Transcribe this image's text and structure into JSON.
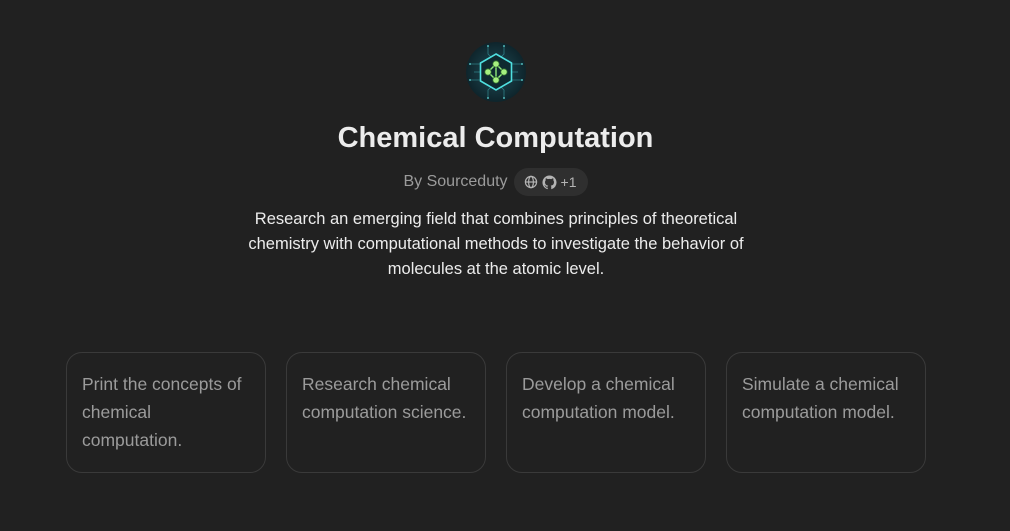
{
  "gpt": {
    "avatar_icon": "molecule-circuit-icon",
    "name": "Chemical Computation",
    "byline": "By Sourceduty",
    "badges": {
      "globe_icon": "globe-icon",
      "github_icon": "github-icon",
      "extra_count": "+1"
    },
    "description": "Research an emerging field that combines principles of theoretical chemistry with computational methods to investigate the behavior of molecules at the atomic level."
  },
  "prompts": [
    {
      "text": "Print the concepts of chemical computation."
    },
    {
      "text": "Research chemical computation science."
    },
    {
      "text": "Develop a chemical computation model."
    },
    {
      "text": "Simulate a chemical computation model."
    }
  ],
  "colors": {
    "background": "#212121",
    "title_text": "#ececec",
    "muted_text": "#9b9b9b",
    "card_border": "#3a3a3a",
    "avatar_accent": "#2ec4c9"
  }
}
